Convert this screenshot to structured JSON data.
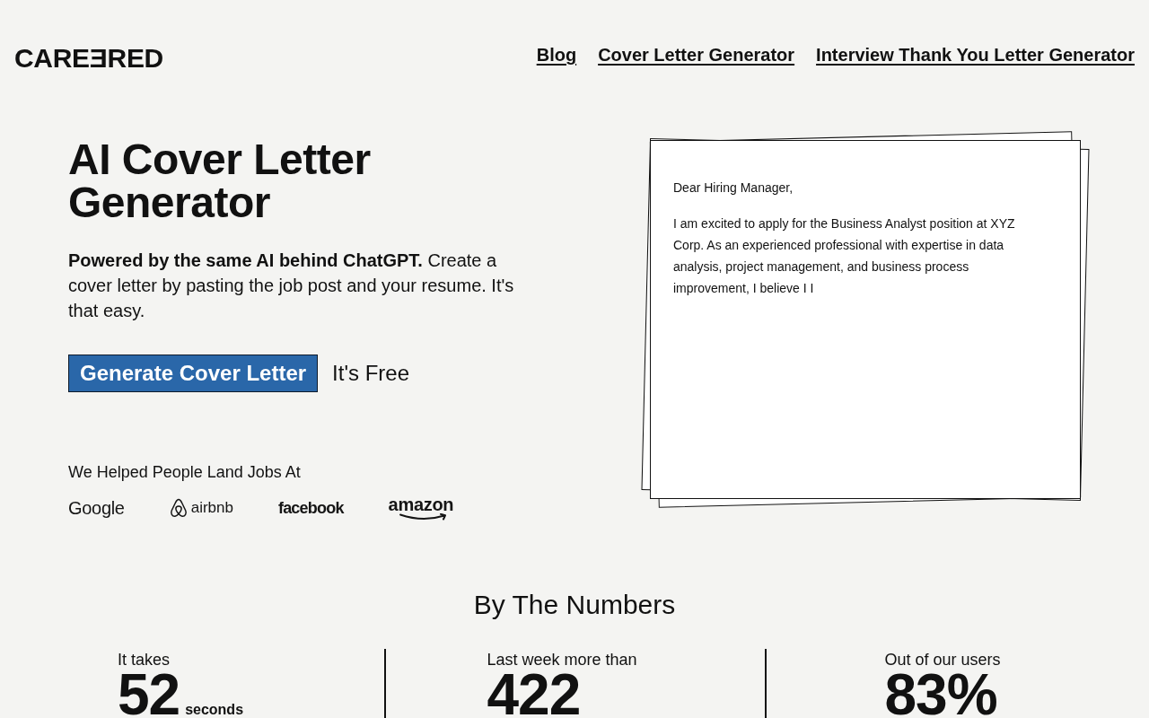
{
  "header": {
    "logo": "CAREƎRED",
    "nav_links": [
      "Blog",
      "Cover Letter Generator",
      "Interview Thank You Letter Generator"
    ]
  },
  "hero": {
    "title": "AI Cover Letter Generator",
    "description": "**Powered by the same AI behind ChatGPT.** Create a cover letter by pasting the job post and your resume. It's that easy.",
    "cta_button": "Generate Cover Letter",
    "cta_note": "It's Free",
    "companies_heading": "We Helped People Land Jobs At",
    "companies": [
      {
        "name": "Google",
        "kind": "plain"
      },
      {
        "name": "airbnb",
        "kind": "mark"
      },
      {
        "name": "facebook",
        "kind": "heavy"
      },
      {
        "name": "amazon",
        "kind": "smile"
      }
    ]
  },
  "letter_preview": {
    "greeting": "Dear Hiring Manager,",
    "body": "I am excited to apply for the Business Analyst position at XYZ Corp. As an experienced professional with expertise in data analysis, project management, and business process improvement, I believe I I"
  },
  "numbers": {
    "title": "By The Numbers",
    "stats": [
      {
        "label": "It takes",
        "value": "52",
        "unit": "seconds"
      },
      {
        "label": "Last week more than",
        "value": "422"
      },
      {
        "label": "Out of our users",
        "value": "83%"
      }
    ]
  }
}
